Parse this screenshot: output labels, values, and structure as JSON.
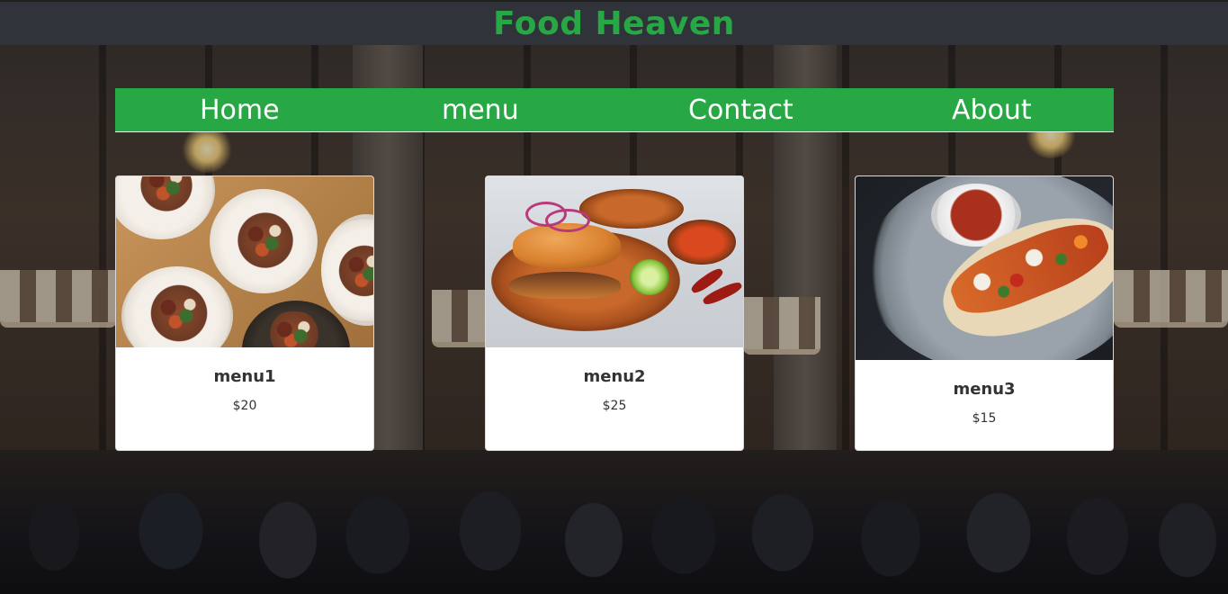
{
  "header": {
    "title": "Food Heaven"
  },
  "nav": {
    "items": [
      {
        "label": "Home"
      },
      {
        "label": "menu"
      },
      {
        "label": "Contact"
      },
      {
        "label": "About"
      }
    ]
  },
  "cards": [
    {
      "title": "menu1",
      "price": "$20",
      "image": "food-platter-image"
    },
    {
      "title": "menu2",
      "price": "$25",
      "image": "torta-image"
    },
    {
      "title": "menu3",
      "price": "$15",
      "image": "taco-image"
    }
  ],
  "colors": {
    "accent": "#28a745",
    "header_bg": "#31333a",
    "card_bg": "#ffffff",
    "text": "#333333"
  }
}
